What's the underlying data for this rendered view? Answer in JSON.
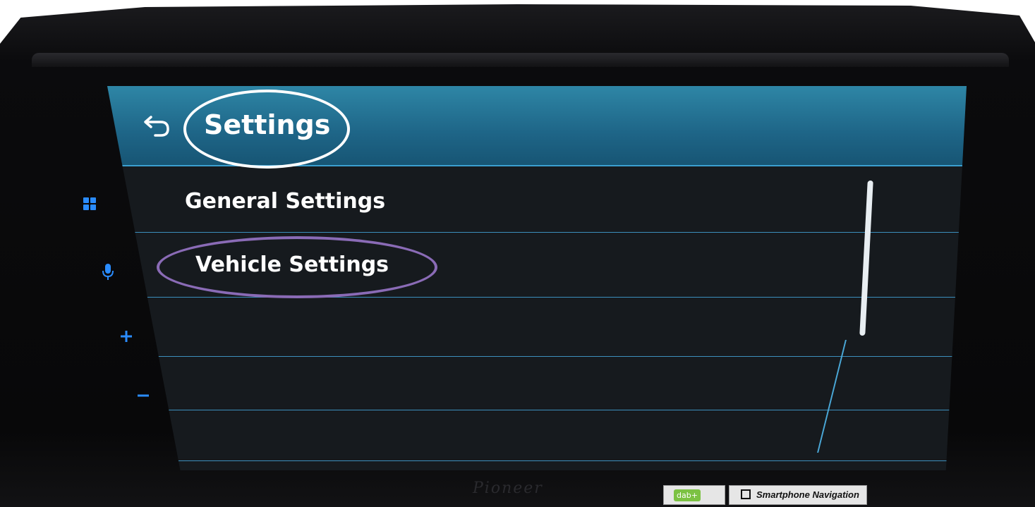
{
  "header": {
    "title": "Settings",
    "back_icon": "back-arrow-icon"
  },
  "menu": {
    "items": [
      {
        "label": "General Settings"
      },
      {
        "label": "Vehicle Settings"
      },
      {
        "label": ""
      },
      {
        "label": ""
      },
      {
        "label": ""
      }
    ]
  },
  "hardware": {
    "side_buttons": [
      "home-grid-icon",
      "microphone-icon",
      "volume-up-icon",
      "volume-down-icon"
    ],
    "brand": "Pioneer",
    "badges": {
      "dab": "dab+",
      "nav": "Smartphone Navigation"
    }
  },
  "colors": {
    "header_bg": "#1e6587",
    "divider": "#3c8fbd",
    "title_highlight": "#ffffff",
    "item_highlight": "#8a6bb6",
    "hardware_buttons": "#2a8cff"
  }
}
